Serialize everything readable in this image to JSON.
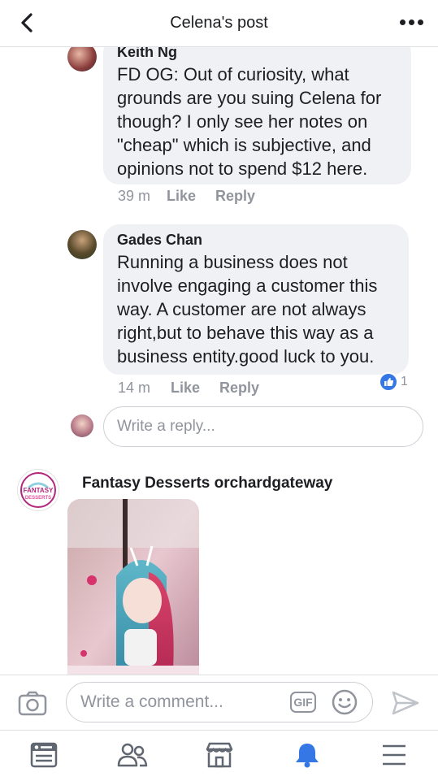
{
  "header": {
    "title": "Celena's post"
  },
  "comments": [
    {
      "name": "Keith Ng",
      "text": "FD OG: Out of curiosity, what grounds are you suing Celena for though? I only see her notes on \"cheap\" which is subjective, and opinions not to spend $12 here.",
      "time": "39 m",
      "like_label": "Like",
      "reply_label": "Reply"
    },
    {
      "name": "Gades Chan",
      "text": "Running a business does not involve engaging a customer this way. A customer are not always right,but to behave this way as a business entity.good luck to you.",
      "time": "14 m",
      "like_label": "Like",
      "reply_label": "Reply",
      "reaction_count": "1"
    }
  ],
  "reply_box": {
    "placeholder": "Write a reply..."
  },
  "page_comment": {
    "name": "Fantasy Desserts orchardgateway",
    "logo_text": "FANTASY DESSERTS"
  },
  "composer": {
    "placeholder": "Write a comment...",
    "gif_label": "GIF"
  },
  "tabbar": {
    "items": [
      "news-feed-icon",
      "friends-icon",
      "marketplace-icon",
      "notifications-icon",
      "menu-icon"
    ],
    "active_color": "#3578e5"
  },
  "colors": {
    "accent": "#3578e5",
    "bubble": "#f0f1f4",
    "muted": "#90949c"
  }
}
